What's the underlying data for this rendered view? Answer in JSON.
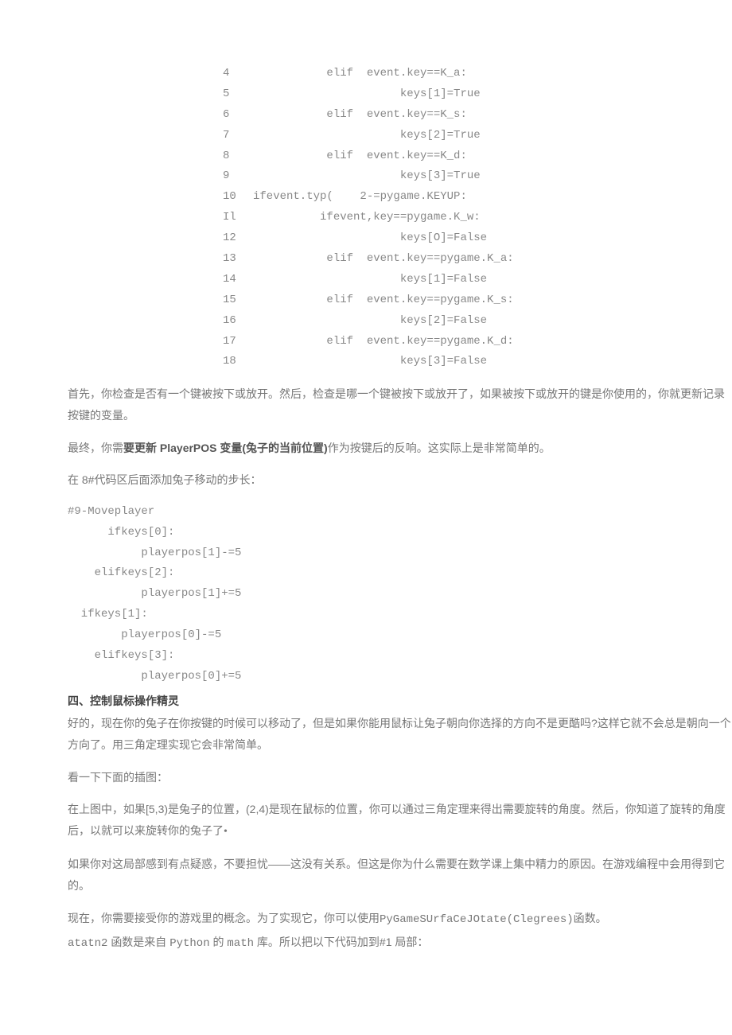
{
  "code1": [
    {
      "n": "4",
      "t": "           elif  event.key==K_a:"
    },
    {
      "n": "5",
      "t": "                      keys[1]=True"
    },
    {
      "n": "6",
      "t": "           elif  event.key==K_s:"
    },
    {
      "n": "7",
      "t": "                      keys[2]=True"
    },
    {
      "n": "8",
      "t": "           elif  event.key==K_d:"
    },
    {
      "n": "9",
      "t": "                      keys[3]=True"
    },
    {
      "n": "10",
      "t": "ifevent.typ(    2-=pygame.KEYUP:"
    },
    {
      "n": "Il",
      "t": "          ifevent,key==pygame.K_w:"
    },
    {
      "n": "12",
      "t": "                      keys[O]=False"
    },
    {
      "n": "13",
      "t": "           elif  event.key==pygame.K_a:"
    },
    {
      "n": "14",
      "t": "                      keys[1]=False"
    },
    {
      "n": "15",
      "t": "           elif  event.key==pygame.K_s:"
    },
    {
      "n": "16",
      "t": "                      keys[2]=False"
    },
    {
      "n": "17",
      "t": "           elif  event.key==pygame.K_d:"
    },
    {
      "n": "18",
      "t": "                      keys[3]=False"
    }
  ],
  "p1": "首先，你检查是否有一个键被按下或放开。然后，检查是哪一个键被按下或放开了，如果被按下或放开的键是你使用的，你就更新记录按键的变量。",
  "p2_a": "最终，你需",
  "p2_b": "要更新 PlayerPOS 变量(兔子的当前位置)",
  "p2_c": "作为按键后的反响。这实际上是非常简单的。",
  "p3": "在 8#代码区后面添加兔子移动的步长：",
  "code2": [
    "#9-Moveplayer",
    "      ifkeys[0]:",
    "           playerpos[1]-=5",
    "    elifkeys[2]:",
    "           playerpos[1]+=5",
    "  ifkeys[1]:",
    "        playerpos[0]-=5",
    "    elifkeys[3]:",
    "           playerpos[0]+=5"
  ],
  "h4": "四、控制鼠标操作精灵",
  "p4": "好的，现在你的兔子在你按键的时候可以移动了，但是如果你能用鼠标让兔子朝向你选择的方向不是更酷吗?这样它就不会总是朝向一个方向了。用三角定理实现它会非常简单。",
  "p5": "看一下下面的插图：",
  "p6_a": "在上图中，如果[5,3)是兔子的位置，(2,4)是现在鼠标的位置，你可以通过三角定理来得出需要旋转的角度。然后，你知道了旋转的角度后，以就可以来旋转你的兔子了",
  "p6_dot": "•",
  "p7": "如果你对这局部感到有点疑惑，不要担忧——这没有关系。但这是你为什么需要在数学课上集中精力的原因。在游戏编程中会用得到它的。",
  "p8_a": "现在，你需要接受你的游戏里的概念。为了实现它，你可以使用",
  "p8_b": "PyGameSUrfaCeJOtate(Clegrees)",
  "p8_c": "函数。",
  "p9_a": "atatn2",
  "p9_b": "函数是来自",
  "p9_c": "Python",
  "p9_d": "的",
  "p9_e": "math",
  "p9_f": "库。所以把以下代码加到#1 局部："
}
